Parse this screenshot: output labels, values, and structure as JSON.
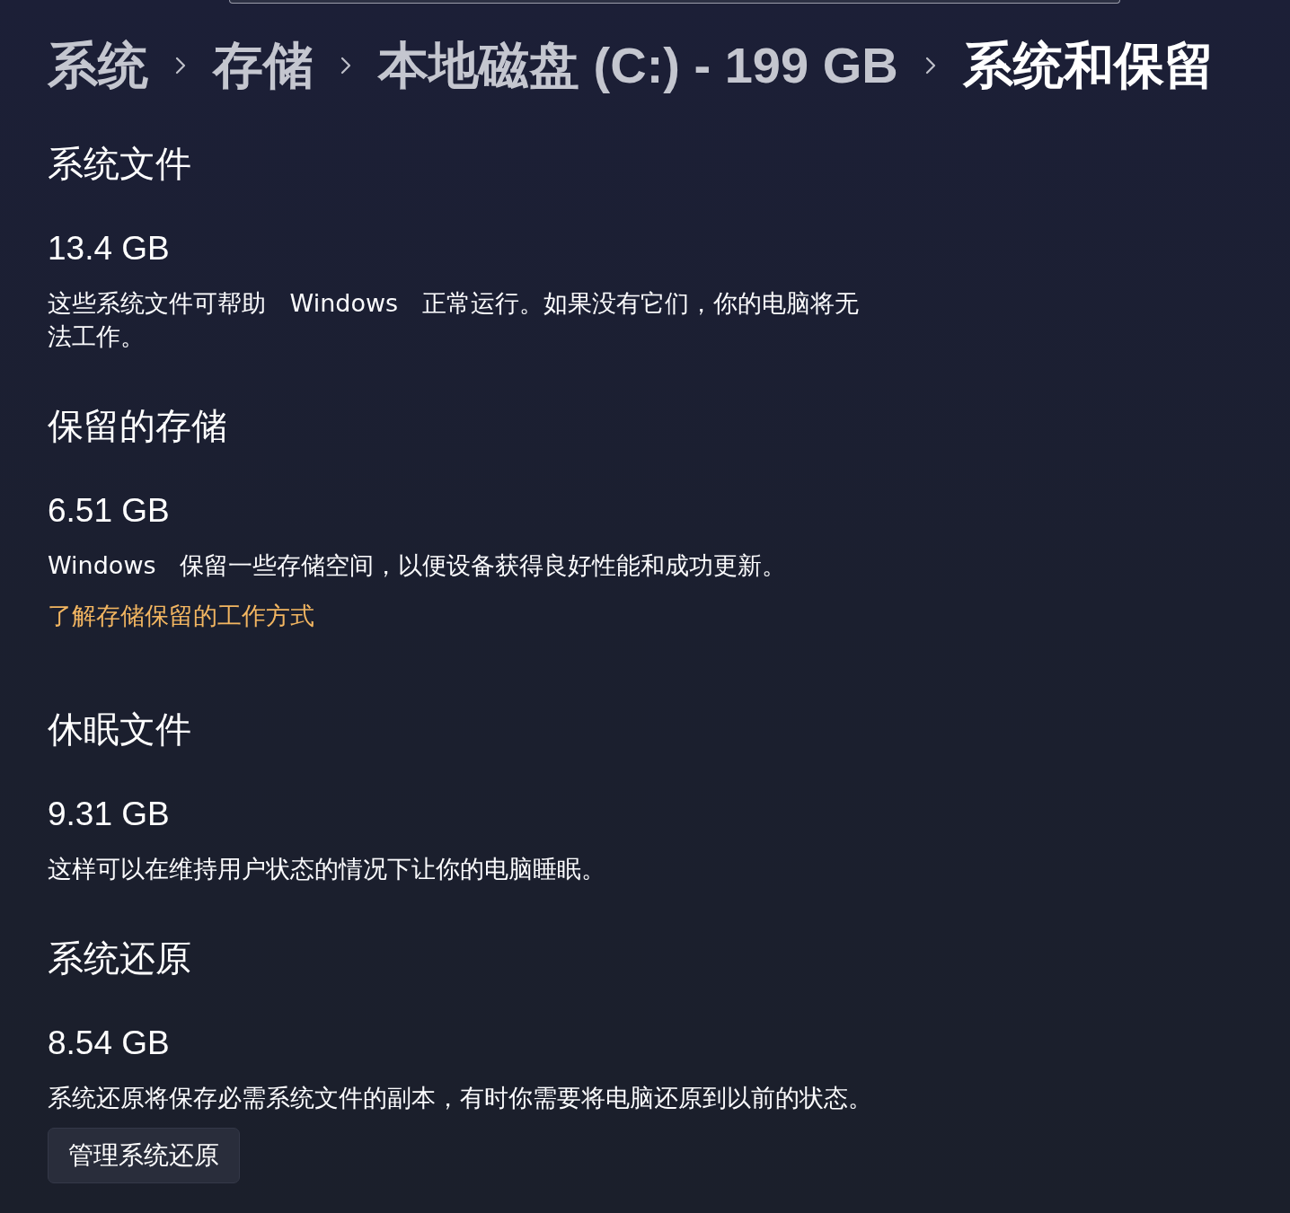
{
  "breadcrumb": [
    {
      "label": "系统",
      "current": false
    },
    {
      "label": "存储",
      "current": false
    },
    {
      "label": "本地磁盘 (C:) - 199 GB",
      "current": false
    },
    {
      "label": "系统和保留",
      "current": true
    }
  ],
  "sections": [
    {
      "title": "系统文件",
      "size": "13.4 GB",
      "description": "这些系统文件可帮助 Windows 正常运行。如果没有它们，你的电脑将无法工作。"
    },
    {
      "title": "保留的存储",
      "size": "6.51 GB",
      "description": "Windows 保留一些存储空间，以便设备获得良好性能和成功更新。",
      "link": "了解存储保留的工作方式"
    },
    {
      "title": "休眠文件",
      "size": "9.31 GB",
      "description": "这样可以在维持用户状态的情况下让你的电脑睡眠。"
    },
    {
      "title": "系统还原",
      "size": "8.54 GB",
      "description": "系统还原将保存必需系统文件的副本，有时你需要将电脑还原到以前的状态。",
      "button": "管理系统还原"
    }
  ]
}
